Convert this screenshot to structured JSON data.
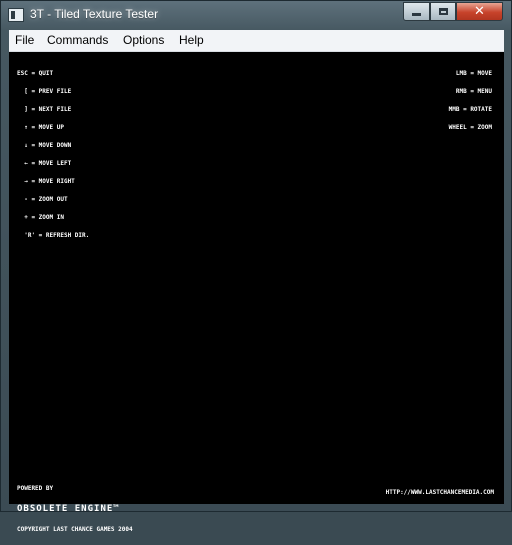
{
  "window": {
    "title": "3T - Tiled Texture Tester",
    "icon": "app-window-icon"
  },
  "title_controls": {
    "minimize_icon": "minimize-icon",
    "maximize_icon": "maximize-icon",
    "close_glyph": "✕"
  },
  "menubar": {
    "items": [
      "File",
      "Commands",
      "Options",
      "Help"
    ]
  },
  "viewport": {
    "help_left": [
      "ESC = QUIT",
      "  [ = PREV FILE",
      "  ] = NEXT FILE",
      "  ↑ = MOVE UP",
      "  ↓ = MOVE DOWN",
      "  ← = MOVE LEFT",
      "  → = MOVE RIGHT",
      "  - = ZOOM OUT",
      "  + = ZOOM IN",
      "  'R' = REFRESH DIR."
    ],
    "help_right": [
      "LMB = MOVE",
      "RMB = MENU",
      "MMB = ROTATE",
      "WHEEL = ZOOM"
    ],
    "footer": {
      "powered_by": "POWERED BY",
      "engine": "OBSOLETE ENGINE™",
      "copyright": "COPYRIGHT LAST CHANCE GAMES 2004",
      "url": "HTTP://WWW.LASTCHANCEMEDIA.COM"
    }
  }
}
